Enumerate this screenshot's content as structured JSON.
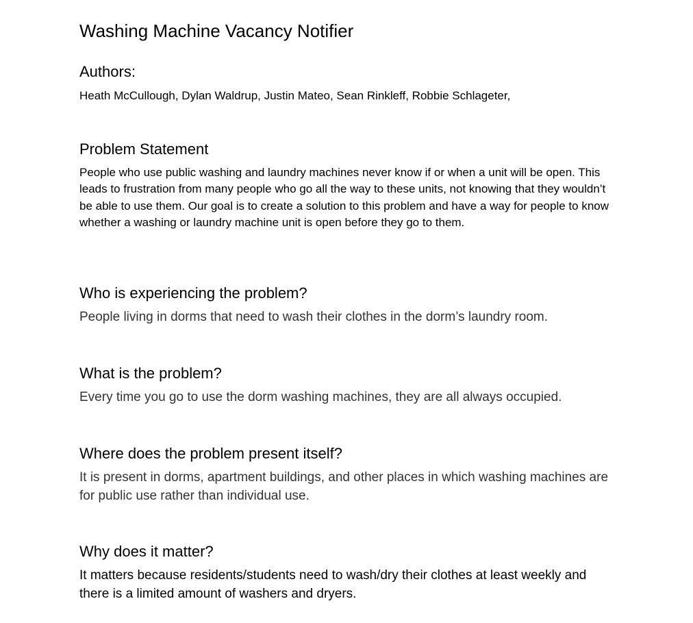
{
  "document": {
    "title": "Washing Machine Vacancy Notifier",
    "authors_heading": "Authors:",
    "authors_text": "Heath McCullough, Dylan Waldrup, Justin Mateo, Sean Rinkleff, Robbie Schlageter,",
    "sections": [
      {
        "heading": "Problem Statement",
        "body": "People who use public washing and laundry machines never know if or when a unit will be open. This leads to frustration from many people who go all the way to these units, not knowing that they wouldn’t be able to use them. Our goal is to create a solution to this problem and have a way for people to know whether a washing or laundry machine unit is open before they go to them."
      },
      {
        "heading": "Who is experiencing the problem?",
        "body": "People living in dorms that need to wash their clothes in the dorm’s laundry room."
      },
      {
        "heading": "What is the problem?",
        "body": "Every time you go to use the dorm washing machines, they are all always occupied."
      },
      {
        "heading": "Where does the problem present itself?",
        "body": "It is present in dorms, apartment buildings, and other places in which washing machines are for public use rather than individual use."
      },
      {
        "heading": "Why does it matter?",
        "body": "It matters because residents/students need to wash/dry their clothes at least weekly and there is a limited amount of washers and dryers."
      }
    ]
  }
}
